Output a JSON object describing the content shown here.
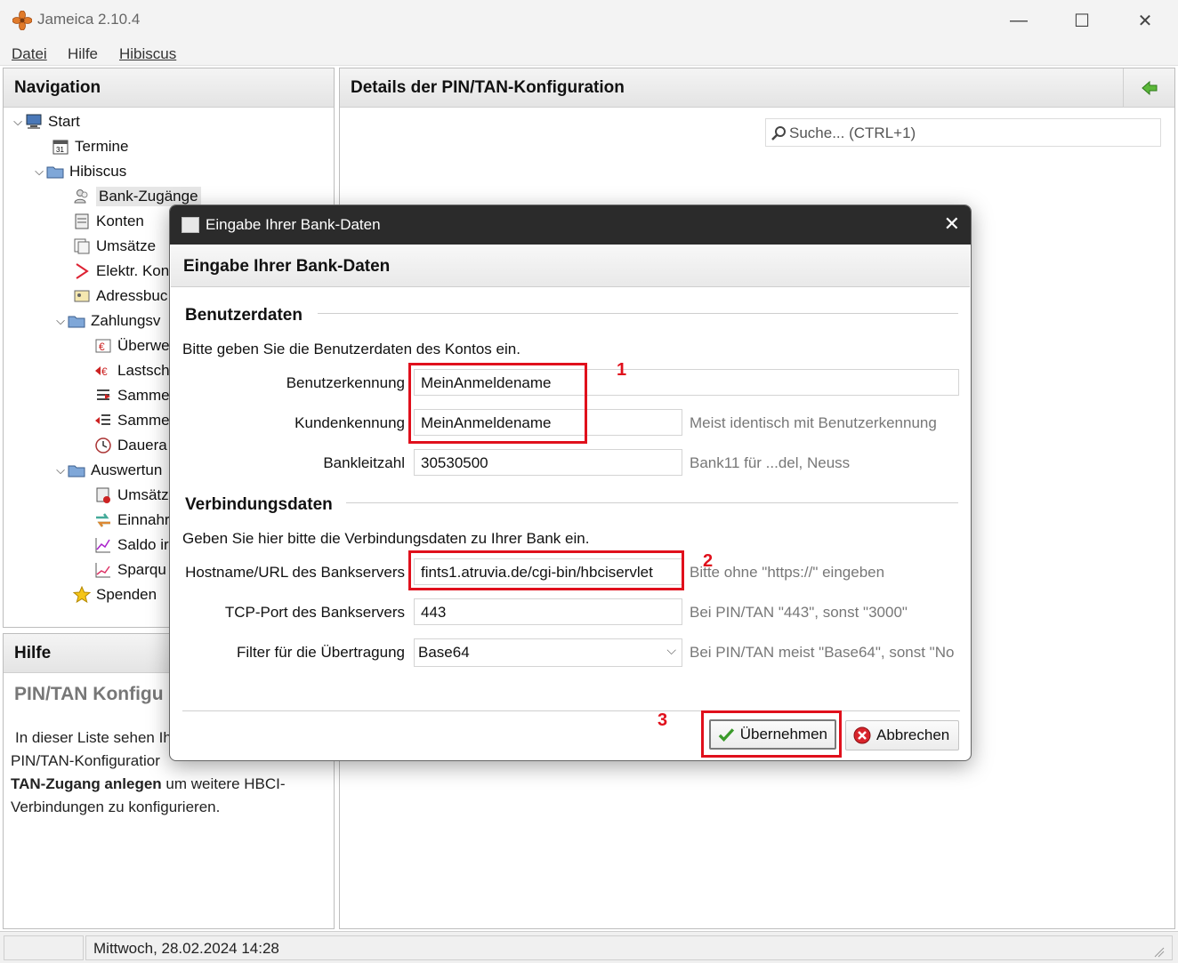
{
  "window": {
    "title": "Jameica 2.10.4",
    "minimize": "—",
    "maximize": "☐",
    "close": "✕"
  },
  "menu": {
    "datei": "Datei",
    "hilfe": "Hilfe",
    "hibiscus": "Hibiscus"
  },
  "navigation": {
    "title": "Navigation",
    "items": [
      {
        "label": "Start",
        "icon": "computer-icon"
      },
      {
        "label": "Termine",
        "icon": "calendar-icon"
      },
      {
        "label": "Hibiscus",
        "icon": "folder-icon"
      },
      {
        "label": "Bank-Zugänge",
        "icon": "users-icon"
      },
      {
        "label": "Konten",
        "icon": "ledger-icon"
      },
      {
        "label": "Umsätze",
        "icon": "documents-icon"
      },
      {
        "label": "Elektr. Kon",
        "icon": "pdf-icon"
      },
      {
        "label": "Adressbuc",
        "icon": "addressbook-icon"
      },
      {
        "label": "Zahlungsv",
        "icon": "folder-icon"
      },
      {
        "label": "Überwe",
        "icon": "euro-icon"
      },
      {
        "label": "Lastsch",
        "icon": "euro-red-icon"
      },
      {
        "label": "Samme",
        "icon": "list-icon"
      },
      {
        "label": "Samme",
        "icon": "list-red-icon"
      },
      {
        "label": "Dauera",
        "icon": "clock-icon"
      },
      {
        "label": "Auswertun",
        "icon": "folder-icon"
      },
      {
        "label": "Umsätz",
        "icon": "report-icon"
      },
      {
        "label": "Einnahr",
        "icon": "arrows-icon"
      },
      {
        "label": "Saldo ir",
        "icon": "chart-icon"
      },
      {
        "label": "Sparqu",
        "icon": "chart-icon"
      },
      {
        "label": "Spenden",
        "icon": "star-icon"
      }
    ]
  },
  "details": {
    "title": "Details der PIN/TAN-Konfiguration",
    "search_placeholder": "Suche...    (CTRL+1)"
  },
  "help": {
    "title": "Hilfe",
    "heading": "PIN/TAN Konfigu",
    "line1": "In dieser Liste sehen Ih",
    "line2": "PIN/TAN-Konfiguratior",
    "line3_bold": "TAN-Zugang anlegen",
    "line3_rest": " um weitere HBCI-",
    "line4": "Verbindungen zu konfigurieren."
  },
  "status": {
    "datetime": "Mittwoch, 28.02.2024 14:28"
  },
  "dialog": {
    "window_title": "Eingabe Ihrer Bank-Daten",
    "heading": "Eingabe Ihrer Bank-Daten",
    "section_user": "Benutzerdaten",
    "user_desc": "Bitte geben Sie die Benutzerdaten des Kontos ein.",
    "benutzerkennung_label": "Benutzerkennung",
    "benutzerkennung_value": "MeinAnmeldename",
    "kundenkennung_label": "Kundenkennung",
    "kundenkennung_value": "MeinAnmeldename",
    "kundenkennung_hint": "Meist identisch mit Benutzerkennung",
    "blz_label": "Bankleitzahl",
    "blz_value": "30530500",
    "blz_hint": "Bank11 für ...del, Neuss",
    "section_conn": "Verbindungsdaten",
    "conn_desc": "Geben Sie hier bitte die Verbindungsdaten zu Ihrer Bank ein.",
    "host_label": "Hostname/URL des Bankservers",
    "host_value": "fints1.atruvia.de/cgi-bin/hbciservlet",
    "host_hint": "Bitte ohne \"https://\" eingeben",
    "port_label": "TCP-Port des Bankservers",
    "port_value": "443",
    "port_hint": "Bei PIN/TAN \"443\", sonst \"3000\"",
    "filter_label": "Filter für die Übertragung",
    "filter_value": "Base64",
    "filter_hint": "Bei PIN/TAN meist \"Base64\", sonst \"No",
    "ok_label": "Übernehmen",
    "cancel_label": "Abbrechen"
  },
  "annotations": {
    "a1": "1",
    "a2": "2",
    "a3": "3"
  },
  "colors": {
    "annotation": "#e0101c",
    "dialog_titlebar": "#2b2b2b"
  }
}
